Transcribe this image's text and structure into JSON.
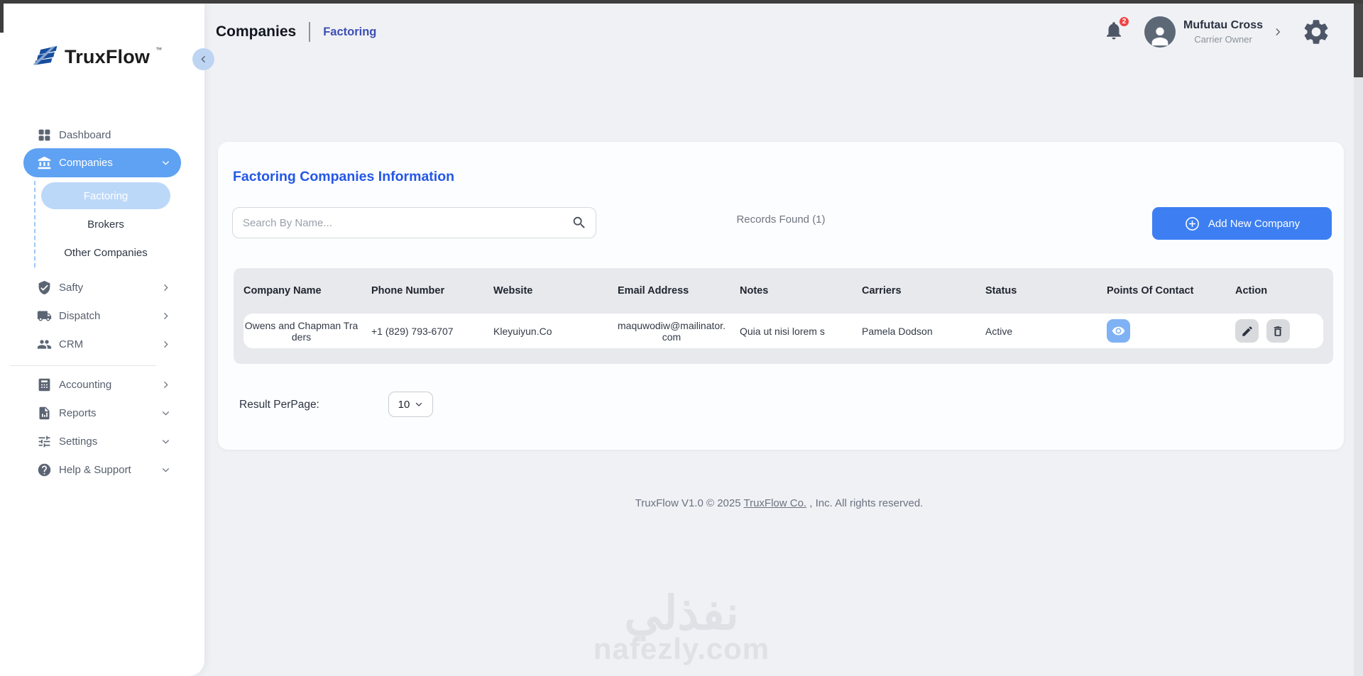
{
  "brand": {
    "name": "TruxFlow",
    "tm": "™"
  },
  "header": {
    "breadcrumb_primary": "Companies",
    "breadcrumb_secondary": "Factoring",
    "notification_count": "2",
    "user_name": "Mufutau Cross",
    "user_role": "Carrier Owner"
  },
  "sidebar": {
    "items": [
      {
        "label": "Dashboard"
      },
      {
        "label": "Companies"
      },
      {
        "label": "Factoring"
      },
      {
        "label": "Brokers"
      },
      {
        "label": "Other Companies"
      },
      {
        "label": "Safty"
      },
      {
        "label": "Dispatch"
      },
      {
        "label": "CRM"
      },
      {
        "label": "Accounting"
      },
      {
        "label": "Reports"
      },
      {
        "label": "Settings"
      },
      {
        "label": "Help & Support"
      }
    ]
  },
  "main": {
    "title": "Factoring Companies Information",
    "search_placeholder": "Search By Name...",
    "records_found": "Records Found (1)",
    "add_button_label": "Add New Company",
    "table": {
      "headers": [
        "Company Name",
        "Phone Number",
        "Website",
        "Email Address",
        "Notes",
        "Carriers",
        "Status",
        "Points Of Contact",
        "Action"
      ],
      "rows": [
        {
          "company_name": "Owens and Chapman Traders",
          "phone": "+1 (829) 793-6707",
          "website": "Kleyuiyun.Co",
          "email": "maquwodiw@mailinator.com",
          "notes": "Quia ut nisi lorem s",
          "carriers": "Pamela Dodson",
          "status": "Active"
        }
      ]
    },
    "per_page_label": "Result PerPage:",
    "per_page_value": "10"
  },
  "footer": {
    "text_before": "TruxFlow V1.0 © 2025 ",
    "link_text": "TruxFlow Co.",
    "text_after": " , Inc. All rights reserved."
  },
  "watermark": {
    "arabic": "نفذلي",
    "latin": "nafezly.com"
  },
  "colors": {
    "accent_blue": "#3d7ff2",
    "sidebar_active": "#5fa2f3",
    "sub_active": "#bcd8f9",
    "title_blue": "#2457e6",
    "breadcrumb_indigo": "#3d4eb5",
    "badge_red": "#ee4444",
    "page_bg": "#eff1f4",
    "band_gray": "#e7e9ed"
  }
}
